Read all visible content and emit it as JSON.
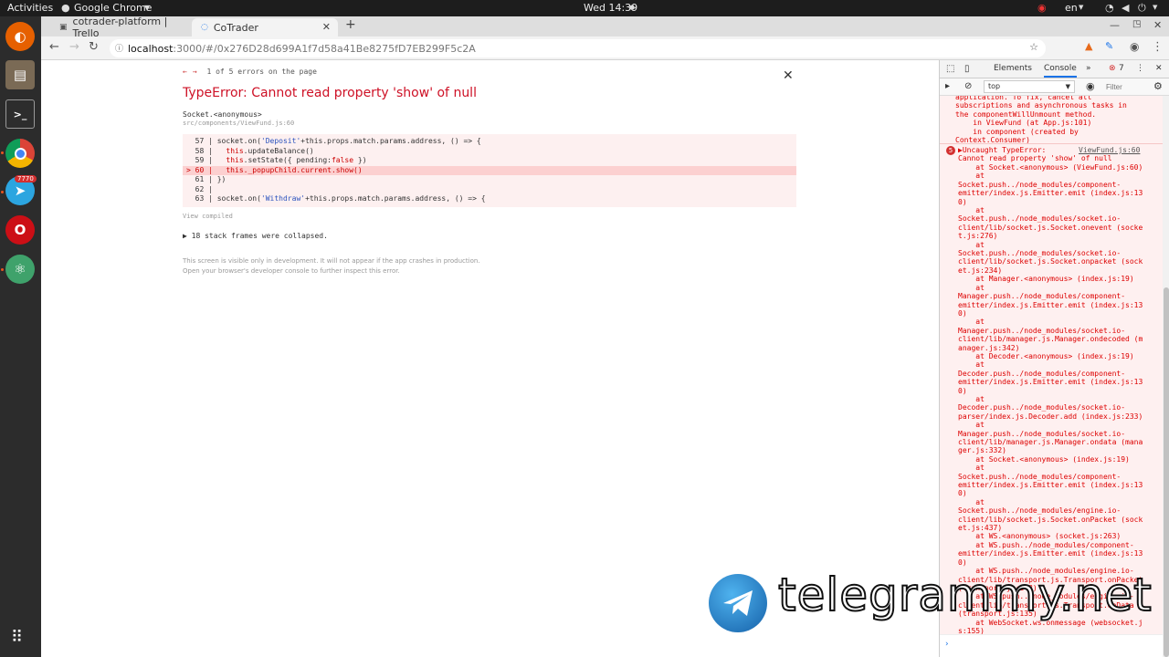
{
  "topbar": {
    "activities": "Activities",
    "app_name": "Google Chrome",
    "clock": "Wed 14:39",
    "language": "en"
  },
  "dock": {
    "items": [
      {
        "name": "firefox",
        "color": "#e66000"
      },
      {
        "name": "files",
        "color": "#8a6d3b"
      },
      {
        "name": "terminal",
        "color": "#2d2d2d"
      },
      {
        "name": "chrome",
        "color": "#4285f4"
      },
      {
        "name": "telegram",
        "color": "#2ca5e0",
        "badge": "7770"
      },
      {
        "name": "opera",
        "color": "#cc0f16"
      },
      {
        "name": "atom",
        "color": "#3fa26b"
      }
    ],
    "apps_grid": "show-applications"
  },
  "browser": {
    "tabs": [
      {
        "label": "cotrader-platform | Trello",
        "active": false
      },
      {
        "label": "CoTrader",
        "active": true
      }
    ],
    "url_host": "localhost",
    "url_path": ":3000/#/0x276D28d699A1f7d58a41Be8275fD7EB299F5c2A"
  },
  "error_overlay": {
    "counter": "1 of 5 errors on the page",
    "title": "TypeError: Cannot read property 'show' of null",
    "frame_function": "Socket.<anonymous>",
    "frame_file": "src/components/ViewFund.js:60",
    "code_lines": [
      {
        "num": "57",
        "pre": "socket.on(",
        "str": "'Deposit'",
        "post": "+this.props.match.params.address, () => {",
        "highlight": false
      },
      {
        "num": "58",
        "pre": "  ",
        "kw": "this",
        "post": ".updateBalance()",
        "highlight": false
      },
      {
        "num": "59",
        "pre": "  ",
        "kw": "this",
        "post": ".setState({ pending:",
        "kw2": "false",
        "post2": " })",
        "highlight": false
      },
      {
        "num": "60",
        "pre": "  this._popupChild.current.show()",
        "highlight": true
      },
      {
        "num": "61",
        "pre": "})",
        "highlight": false
      },
      {
        "num": "62",
        "pre": "",
        "highlight": false
      },
      {
        "num": "63",
        "pre": "socket.on(",
        "str": "'Withdraw'",
        "post": "+this.props.match.params.address, () => {",
        "highlight": false
      }
    ],
    "view_compiled": "View compiled",
    "collapsed_frames": "▶ 18 stack frames were collapsed.",
    "footnote_1": "This screen is visible only in development. It will not appear if the app crashes in production.",
    "footnote_2": "Open your browser's developer console to further inspect this error."
  },
  "devtools": {
    "tabs": [
      "Elements",
      "Console"
    ],
    "active_tab": "Console",
    "error_count": "7",
    "context": "top",
    "filter_placeholder": "Filter",
    "prev_message": "application. To fix, cancel all\nsubscriptions and asynchronous tasks in\nthe componentWillUnmount method.\n    in ViewFund (at App.js:101)\n    in component (created by\nContext.Consumer)",
    "error_badge": "5",
    "error_source": "ViewFund.js:60",
    "error_head": "▶Uncaught TypeError:\nCannot read property 'show' of null",
    "stack": "    at Socket.<anonymous> (ViewFund.js:60)\n    at\nSocket.push../node_modules/component-\nemitter/index.js.Emitter.emit (index.js:13\n0)\n    at\nSocket.push../node_modules/socket.io-\nclient/lib/socket.js.Socket.onevent (socke\nt.js:276)\n    at\nSocket.push../node_modules/socket.io-\nclient/lib/socket.js.Socket.onpacket (sock\net.js:234)\n    at Manager.<anonymous> (index.js:19)\n    at\nManager.push../node_modules/component-\nemitter/index.js.Emitter.emit (index.js:13\n0)\n    at\nManager.push../node_modules/socket.io-\nclient/lib/manager.js.Manager.ondecoded (m\nanager.js:342)\n    at Decoder.<anonymous> (index.js:19)\n    at\nDecoder.push../node_modules/component-\nemitter/index.js.Emitter.emit (index.js:13\n0)\n    at\nDecoder.push../node_modules/socket.io-\nparser/index.js.Decoder.add (index.js:233)\n    at\nManager.push../node_modules/socket.io-\nclient/lib/manager.js.Manager.ondata (mana\nger.js:332)\n    at Socket.<anonymous> (index.js:19)\n    at\nSocket.push../node_modules/component-\nemitter/index.js.Emitter.emit (index.js:13\n0)\n    at\nSocket.push../node_modules/engine.io-\nclient/lib/socket.js.Socket.onPacket (sock\net.js:437)\n    at WS.<anonymous> (socket.js:263)\n    at WS.push../node_modules/component-\nemitter/index.js.Emitter.emit (index.js:13\n0)\n    at WS.push../node_modules/engine.io-\nclient/lib/transport.js.Transport.onPacket\n(transport.js:143)\n    at WS.push../node_modules/engine.io-\nclient/lib/transport.js.Transport.onData\n(transport.js:135)\n    at WebSocket.ws.onmessage (websocket.j\ns:155)"
  },
  "watermark": {
    "text": "telegrammy.net"
  }
}
